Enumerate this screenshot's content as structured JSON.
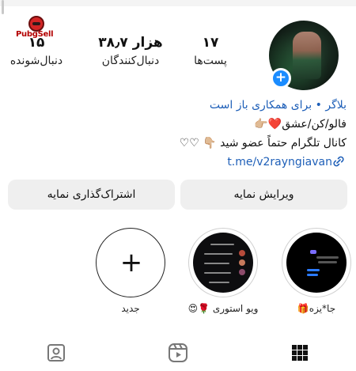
{
  "watermark": {
    "text": "PubgSell"
  },
  "profile": {
    "stats": {
      "posts": {
        "value": "۱۷",
        "label": "پست‌ها"
      },
      "followers": {
        "value": "۳۸٫۷ هزار",
        "label": "دنبال‌کنندگان"
      },
      "following": {
        "value": "۱۵",
        "label": "دنبال‌شونده"
      }
    },
    "bio": {
      "category": "بلاگر",
      "separator": " • ",
      "collab": "برای همکاری باز است",
      "line2": "فالو/کن/عشق❤️👉🏼",
      "line3": "کانال تلگرام حتماً عضو شید 👇🏼 ♡♡",
      "link": "t.me/v2rayngiavan"
    }
  },
  "buttons": {
    "edit": "ویرایش نمایه",
    "share": "اشتراک‌گذاری نمایه"
  },
  "highlights": [
    {
      "label": "جا*یزه🎁"
    },
    {
      "label": "ویو استوری 🌹😍"
    },
    {
      "label": "جدید"
    }
  ],
  "tabs": {
    "grid": "grid-icon",
    "reels": "reels-icon",
    "tagged": "tagged-icon"
  },
  "colors": {
    "accent": "#1a8cff",
    "link": "#1e5fb8",
    "button_bg": "#efefef"
  }
}
